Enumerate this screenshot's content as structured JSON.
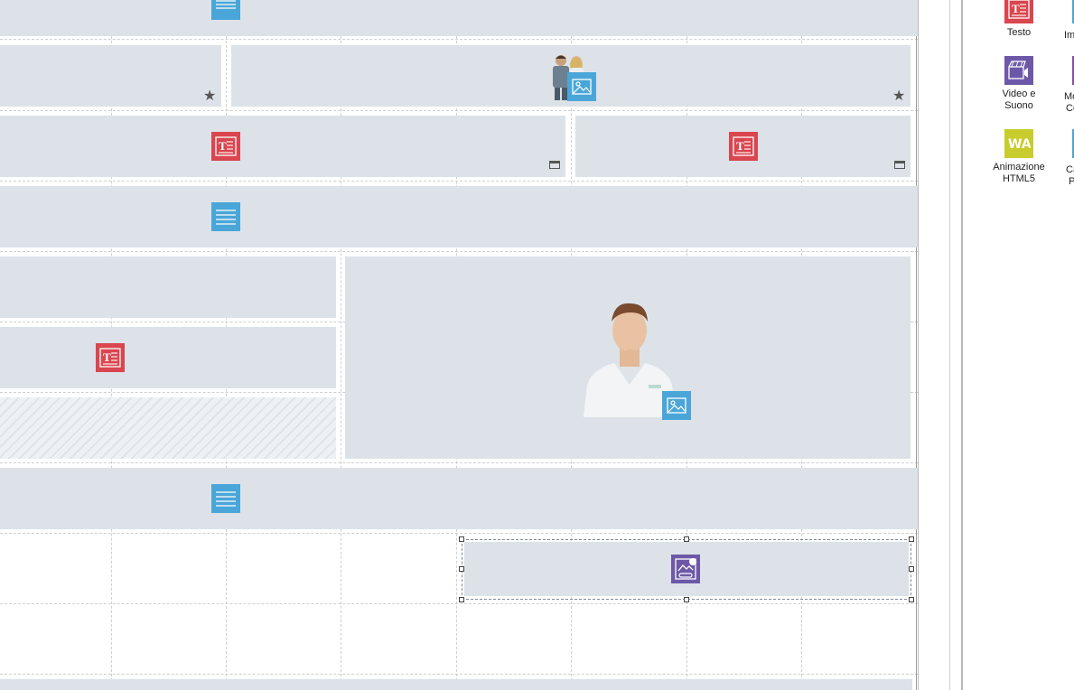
{
  "editor": {
    "canvas": {
      "background": "#ffffff",
      "block_color": "#dce2e8",
      "block_types": [
        "menu",
        "image",
        "text",
        "text",
        "menu",
        "text",
        "image",
        "menu",
        "gallery"
      ]
    },
    "selected_element": "gallery-block"
  },
  "toolbox": {
    "items": [
      {
        "label": "Testo",
        "icon": "text-icon",
        "color": "#d9464f"
      },
      {
        "label": "Im",
        "icon": "image-icon",
        "color": "#4aa6d8"
      },
      {
        "label_line1": "Video e",
        "label_line2": "Suono",
        "icon": "video-sound-icon",
        "color": "#6d58a8"
      },
      {
        "label_line1": "Mo",
        "label_line2": "Co",
        "icon": "module-icon",
        "color": "#8b4ba8"
      },
      {
        "label_line1": "Animazione",
        "label_line2": "HTML5",
        "icon": "html5-animation-icon",
        "color": "#c8cc2c"
      },
      {
        "label_line1": "Ca",
        "label_line2": "P",
        "icon": "unknown-icon",
        "color": "#4aa6d8"
      }
    ]
  },
  "icons": {
    "menu": "menu-icon",
    "text": "text-icon",
    "image": "image-icon",
    "gallery": "gallery-icon",
    "star": "star-icon",
    "window": "window-icon"
  }
}
